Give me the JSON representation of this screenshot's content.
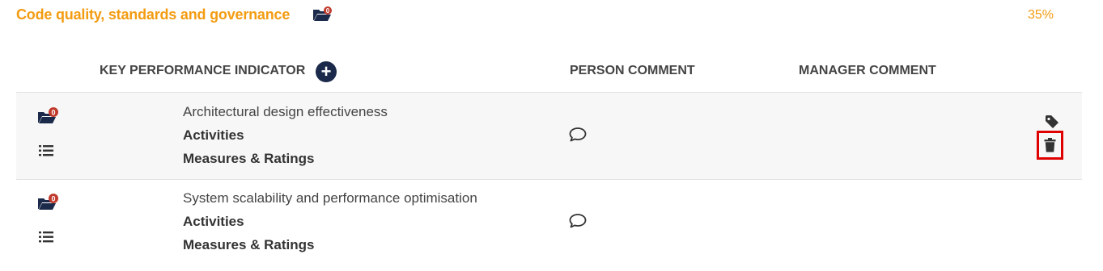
{
  "section": {
    "title": "Code quality, standards and governance",
    "attachment_count": "0",
    "weight_percent": "35%"
  },
  "table": {
    "headers": {
      "kpi": "KEY PERFORMANCE INDICATOR",
      "add": "+",
      "person_comment": "PERSON COMMENT",
      "manager_comment": "MANAGER COMMENT"
    },
    "rows": [
      {
        "attachment_count": "0",
        "name": "Architectural design effectiveness",
        "activities_label": "Activities",
        "measures_label": "Measures & Ratings"
      },
      {
        "attachment_count": "0",
        "name": "System scalability and performance optimisation",
        "activities_label": "Activities",
        "measures_label": "Measures & Ratings"
      }
    ]
  },
  "colors": {
    "accent_orange": "#f39c12",
    "navy": "#1b2a4a",
    "badge_red": "#c0392b",
    "highlight_red": "#e00000"
  },
  "icons": [
    "folder-open-icon",
    "list-icon",
    "comment-icon",
    "tag-icon",
    "trash-icon",
    "plus-icon"
  ]
}
